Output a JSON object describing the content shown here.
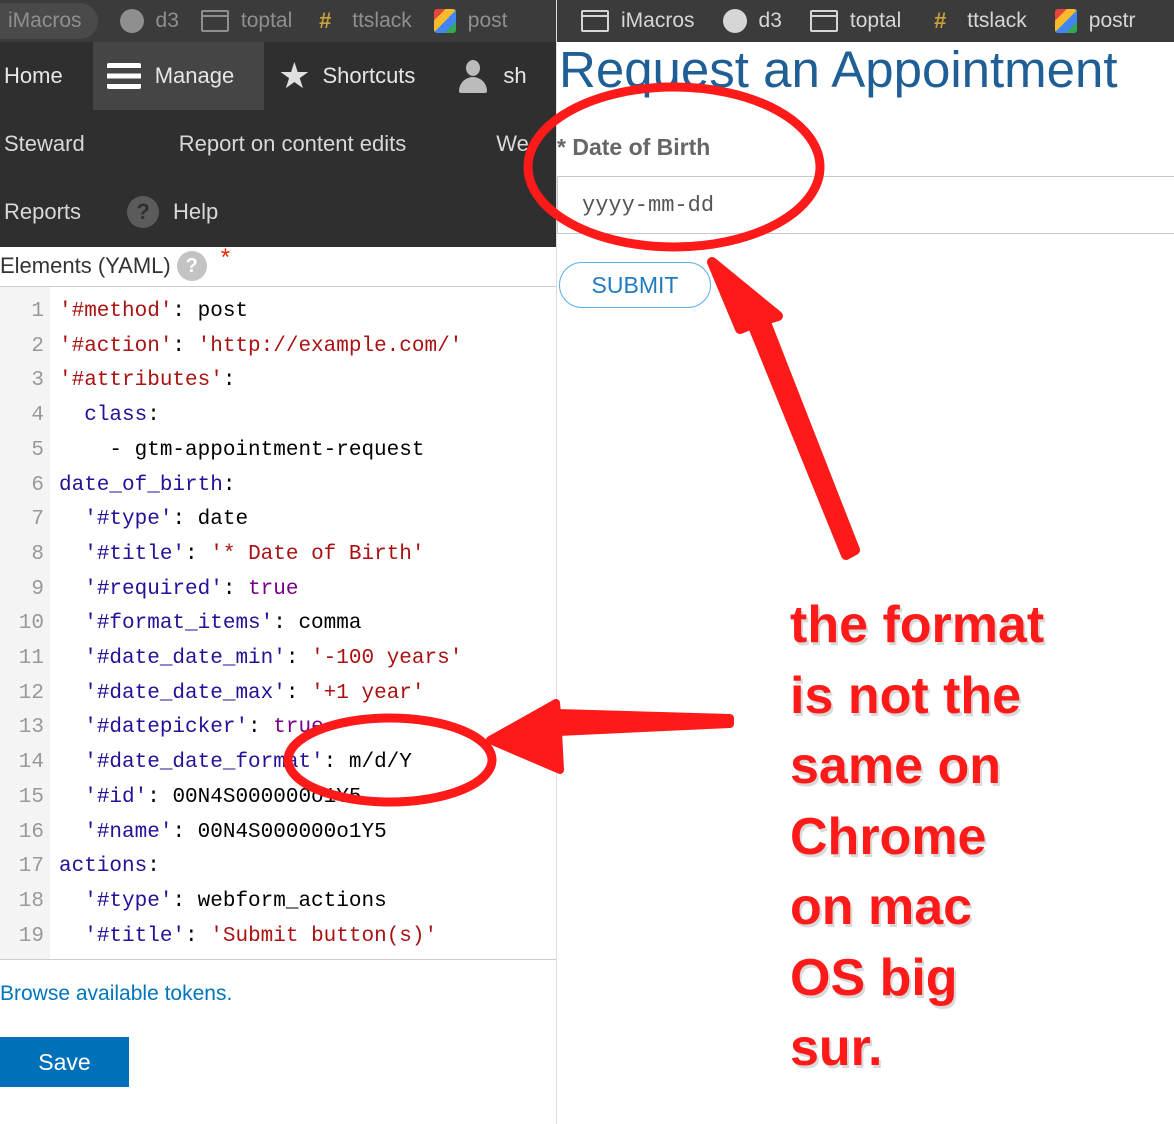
{
  "bookmarks_left": [
    {
      "label": "iMacros",
      "icon": "pill"
    },
    {
      "label": "d3",
      "icon": "github-icon"
    },
    {
      "label": "toptal",
      "icon": "folder-icon"
    },
    {
      "label": "ttslack",
      "icon": "hash-icon"
    },
    {
      "label": "post",
      "icon": "postman-icon"
    }
  ],
  "bookmarks_right": [
    {
      "label": "iMacros",
      "icon": "folder-icon"
    },
    {
      "label": "d3",
      "icon": "github-icon"
    },
    {
      "label": "toptal",
      "icon": "folder-icon"
    },
    {
      "label": "ttslack",
      "icon": "hash-icon"
    },
    {
      "label": "postr",
      "icon": "postman-icon"
    }
  ],
  "toolbar": {
    "home": "Home",
    "manage": "Manage",
    "shortcuts": "Shortcuts",
    "user": "sh",
    "steward": "Steward",
    "report_edits": "Report on content edits",
    "we": "We",
    "reports": "Reports",
    "help": "Help",
    "help_icon": "?"
  },
  "editor": {
    "label": "Elements (YAML)",
    "info_icon": "?",
    "required_mark": "*",
    "lines": [
      {
        "n": "1",
        "parts": [
          [
            "s",
            "'#method'"
          ],
          [
            "",
            ": post"
          ]
        ]
      },
      {
        "n": "2",
        "parts": [
          [
            "s",
            "'#action'"
          ],
          [
            "",
            ": "
          ],
          [
            "s",
            "'http://example.com/'"
          ]
        ]
      },
      {
        "n": "3",
        "parts": [
          [
            "s",
            "'#attributes'"
          ],
          [
            "",
            ":"
          ]
        ]
      },
      {
        "n": "4",
        "parts": [
          [
            "",
            "  "
          ],
          [
            "k",
            "class"
          ],
          [
            "",
            ":"
          ]
        ]
      },
      {
        "n": "5",
        "parts": [
          [
            "",
            "    - gtm-appointment-request"
          ]
        ]
      },
      {
        "n": "6",
        "parts": [
          [
            "k",
            "date_of_birth"
          ],
          [
            "",
            ":"
          ]
        ]
      },
      {
        "n": "7",
        "parts": [
          [
            "",
            "  "
          ],
          [
            "k",
            "'#type'"
          ],
          [
            "",
            ": date"
          ]
        ]
      },
      {
        "n": "8",
        "parts": [
          [
            "",
            "  "
          ],
          [
            "k",
            "'#title'"
          ],
          [
            "",
            ": "
          ],
          [
            "s",
            "'* Date of Birth'"
          ]
        ]
      },
      {
        "n": "9",
        "parts": [
          [
            "",
            "  "
          ],
          [
            "k",
            "'#required'"
          ],
          [
            "",
            ": "
          ],
          [
            "a",
            "true"
          ]
        ]
      },
      {
        "n": "10",
        "parts": [
          [
            "",
            "  "
          ],
          [
            "k",
            "'#format_items'"
          ],
          [
            "",
            ": comma"
          ]
        ]
      },
      {
        "n": "11",
        "parts": [
          [
            "",
            "  "
          ],
          [
            "k",
            "'#date_date_min'"
          ],
          [
            "",
            ": "
          ],
          [
            "s",
            "'-100 years'"
          ]
        ]
      },
      {
        "n": "12",
        "parts": [
          [
            "",
            "  "
          ],
          [
            "k",
            "'#date_date_max'"
          ],
          [
            "",
            ": "
          ],
          [
            "s",
            "'+1 year'"
          ]
        ]
      },
      {
        "n": "13",
        "parts": [
          [
            "",
            "  "
          ],
          [
            "k",
            "'#datepicker'"
          ],
          [
            "",
            ": "
          ],
          [
            "a",
            "true"
          ]
        ]
      },
      {
        "n": "14",
        "parts": [
          [
            "",
            "  "
          ],
          [
            "k",
            "'#date_date_format'"
          ],
          [
            "",
            ": m/d/Y"
          ]
        ]
      },
      {
        "n": "15",
        "parts": [
          [
            "",
            "  "
          ],
          [
            "k",
            "'#id'"
          ],
          [
            "",
            ": 00N4S000000o1Y5"
          ]
        ]
      },
      {
        "n": "16",
        "parts": [
          [
            "",
            "  "
          ],
          [
            "k",
            "'#name'"
          ],
          [
            "",
            ": 00N4S000000o1Y5"
          ]
        ]
      },
      {
        "n": "17",
        "parts": [
          [
            "k",
            "actions"
          ],
          [
            "",
            ":"
          ]
        ]
      },
      {
        "n": "18",
        "parts": [
          [
            "",
            "  "
          ],
          [
            "k",
            "'#type'"
          ],
          [
            "",
            ": webform_actions"
          ]
        ]
      },
      {
        "n": "19",
        "parts": [
          [
            "",
            "  "
          ],
          [
            "k",
            "'#title'"
          ],
          [
            "",
            ": "
          ],
          [
            "s",
            "'Submit button(s)'"
          ]
        ]
      }
    ]
  },
  "tokens_link": "Browse available tokens.",
  "save_label": "Save",
  "form": {
    "title": "Request an Appointment",
    "dob_label": "* Date of Birth",
    "dob_placeholder": "yyyy-mm-dd",
    "submit_label": "SUBMIT"
  },
  "annotation": {
    "lines": [
      "the format",
      "is not the",
      "same on",
      "Chrome",
      "on mac",
      "OS big",
      "sur."
    ],
    "color": "#ff1a1a"
  },
  "colors": {
    "toolbar_bg": "#2f2f2f",
    "link_blue": "#0074bd",
    "save_blue": "#0071b8",
    "title_blue": "#1f5f96"
  }
}
